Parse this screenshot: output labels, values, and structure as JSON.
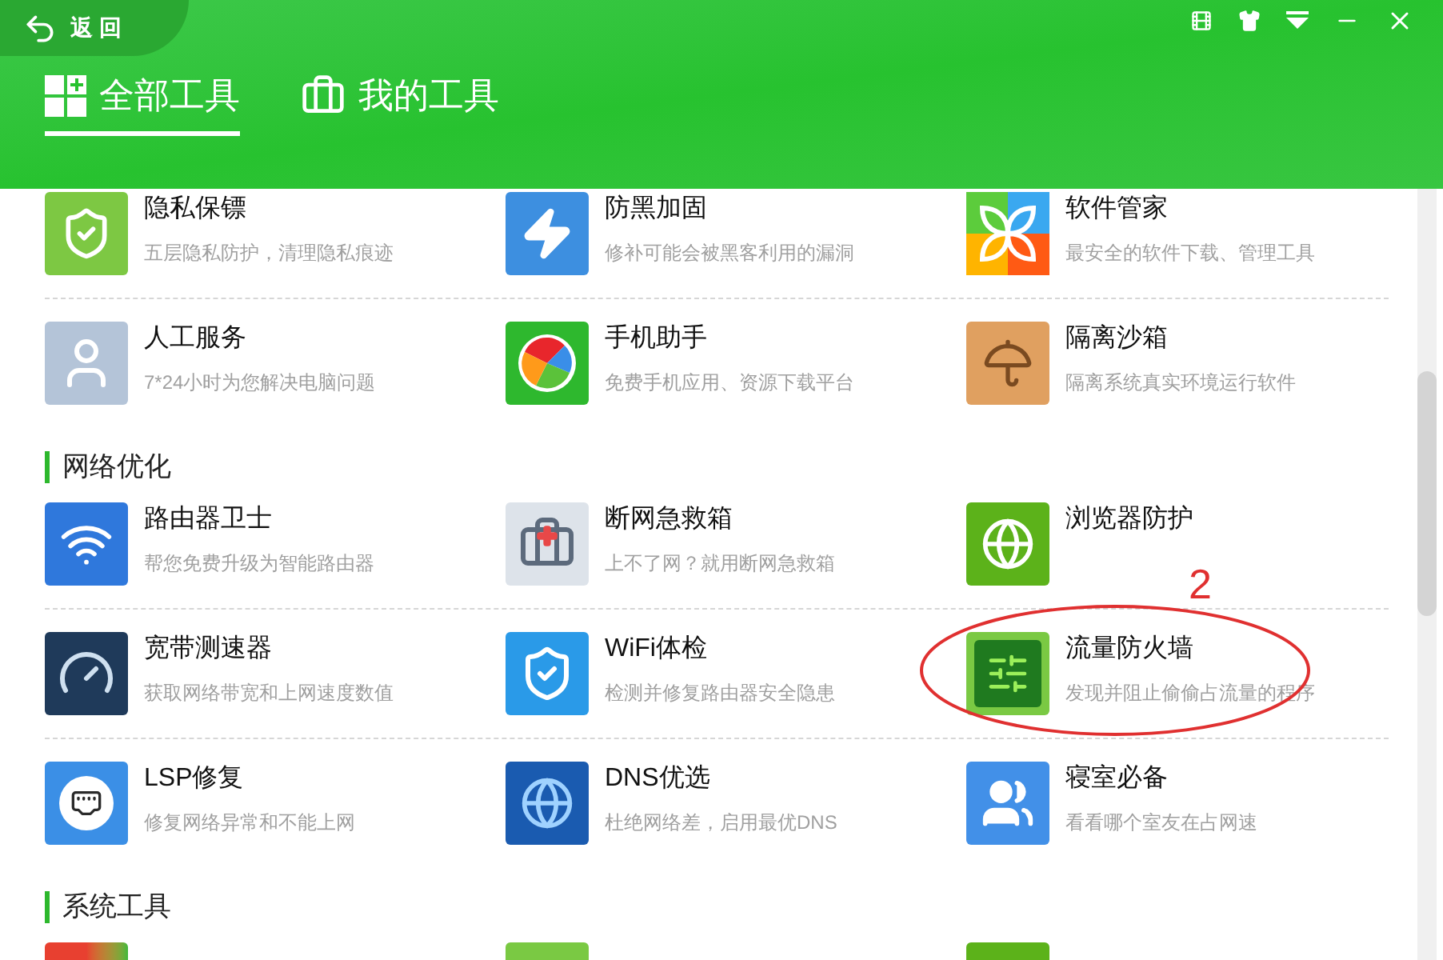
{
  "header": {
    "back": "返 回",
    "tabs": [
      {
        "label": "全部工具",
        "selected": true
      },
      {
        "label": "我的工具",
        "selected": false
      }
    ]
  },
  "sections": [
    {
      "rows": [
        [
          {
            "name": "隐私保镖",
            "desc": "五层隐私防护，清理隐私痕迹"
          },
          {
            "name": "防黑加固",
            "desc": "修补可能会被黑客利用的漏洞"
          },
          {
            "name": "软件管家",
            "desc": "最安全的软件下载、管理工具"
          }
        ],
        [
          {
            "name": "人工服务",
            "desc": "7*24小时为您解决电脑问题"
          },
          {
            "name": "手机助手",
            "desc": "免费手机应用、资源下载平台"
          },
          {
            "name": "隔离沙箱",
            "desc": "隔离系统真实环境运行软件"
          }
        ]
      ]
    },
    {
      "title": "网络优化",
      "rows": [
        [
          {
            "name": "路由器卫士",
            "desc": "帮您免费升级为智能路由器"
          },
          {
            "name": "断网急救箱",
            "desc": "上不了网？就用断网急救箱"
          },
          {
            "name": "浏览器防护"
          }
        ],
        [
          {
            "name": "宽带测速器",
            "desc": "获取网络带宽和上网速度数值"
          },
          {
            "name": "WiFi体检",
            "desc": "检测并修复路由器安全隐患"
          },
          {
            "name": "流量防火墙",
            "desc": "发现并阻止偷偷占流量的程序"
          }
        ],
        [
          {
            "name": "LSP修复",
            "desc": "修复网络异常和不能上网"
          },
          {
            "name": "DNS优选",
            "desc": "杜绝网络差，启用最优DNS"
          },
          {
            "name": "寝室必备",
            "desc": "看看哪个室友在占网速"
          }
        ]
      ]
    },
    {
      "title": "系统工具"
    }
  ],
  "annotation": {
    "label": "2"
  }
}
